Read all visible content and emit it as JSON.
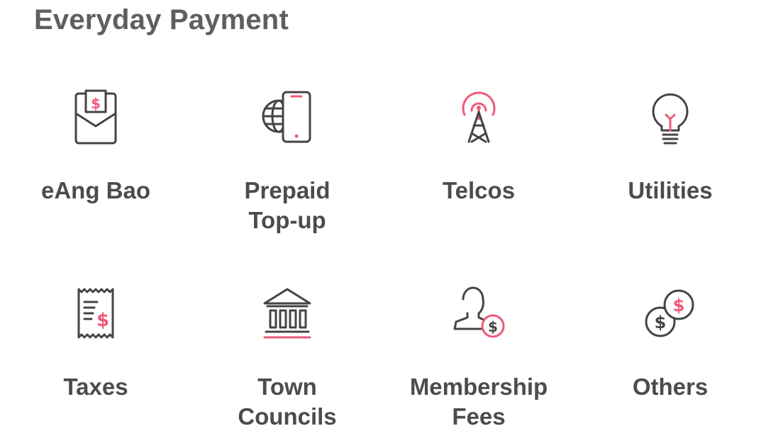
{
  "section": {
    "title": "Everyday Payment"
  },
  "categories": [
    {
      "icon": "red-envelope-icon",
      "lines": [
        "eAng Bao"
      ]
    },
    {
      "icon": "globe-phone-icon",
      "lines": [
        "Prepaid",
        "Top-up"
      ]
    },
    {
      "icon": "transmission-tower-icon",
      "lines": [
        "Telcos"
      ]
    },
    {
      "icon": "light-bulb-icon",
      "lines": [
        "Utilities"
      ]
    },
    {
      "icon": "receipt-icon",
      "lines": [
        "Taxes"
      ]
    },
    {
      "icon": "government-building-icon",
      "lines": [
        "Town",
        "Councils"
      ]
    },
    {
      "icon": "member-dollar-icon",
      "lines": [
        "Membership",
        "Fees"
      ]
    },
    {
      "icon": "coins-icon",
      "lines": [
        "Others"
      ]
    }
  ],
  "colors": {
    "accent": "#ef5a78",
    "icon_stroke": "#444444",
    "title": "#5f5f5f",
    "label": "#4c4c4c"
  }
}
